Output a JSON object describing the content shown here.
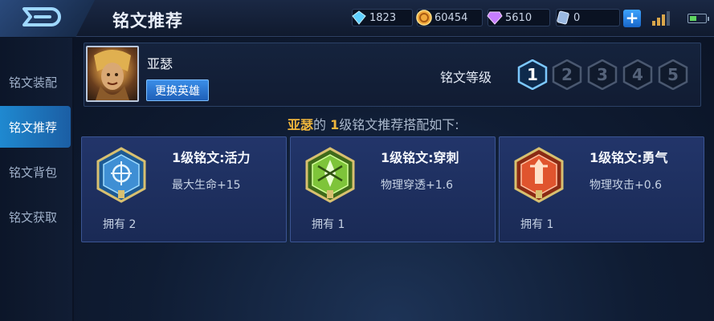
{
  "header": {
    "title": "铭文推荐",
    "back_icon": "back-arrow-icon"
  },
  "resources": [
    {
      "name": "diamond",
      "icon": "diamond-icon",
      "value": "1823",
      "color": "#5fd0ff"
    },
    {
      "name": "gold",
      "icon": "gold-coin-icon",
      "value": "60454",
      "color": "#f2a93b"
    },
    {
      "name": "crystal",
      "icon": "purple-gem-icon",
      "value": "5610",
      "color": "#c67dff"
    },
    {
      "name": "voucher",
      "icon": "voucher-icon",
      "value": "0",
      "color": "#9ab8e0"
    }
  ],
  "sidebar": {
    "items": [
      {
        "label": "铭文装配",
        "active": false
      },
      {
        "label": "铭文推荐",
        "active": true
      },
      {
        "label": "铭文背包",
        "active": false
      },
      {
        "label": "铭文获取",
        "active": false
      }
    ]
  },
  "hero": {
    "name": "亚瑟",
    "change_label": "更换英雄"
  },
  "level_selector": {
    "label": "铭文等级",
    "levels": [
      "1",
      "2",
      "3",
      "4",
      "5"
    ],
    "selected": "1"
  },
  "recommendation": {
    "hero": "亚瑟",
    "middle": "的",
    "level": "1",
    "suffix": "级铭文推荐搭配如下:"
  },
  "cards": [
    {
      "name": "1级铭文:活力",
      "stat": "最大生命+15",
      "owned": "拥有 2",
      "icon": "vitality-emblem-icon",
      "color": "#4fa6e8"
    },
    {
      "name": "1级铭文:穿刺",
      "stat": "物理穿透+1.6",
      "owned": "拥有 1",
      "icon": "pierce-emblem-icon",
      "color": "#7ec43a"
    },
    {
      "name": "1级铭文:勇气",
      "stat": "物理攻击+0.6",
      "owned": "拥有 1",
      "icon": "courage-emblem-icon",
      "color": "#e0542e"
    }
  ],
  "colors": {
    "accent": "#1f89d0",
    "highlight": "#f0b63c"
  }
}
